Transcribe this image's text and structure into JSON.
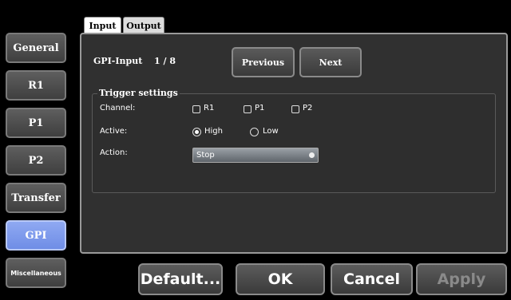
{
  "sidebar": {
    "items": [
      {
        "label": "General"
      },
      {
        "label": "R1"
      },
      {
        "label": "P1"
      },
      {
        "label": "P2"
      },
      {
        "label": "Transfer"
      },
      {
        "label": "GPI"
      },
      {
        "label": "Miscellaneous"
      }
    ],
    "active": "GPI"
  },
  "tabs": [
    {
      "label": "Input"
    },
    {
      "label": "Output"
    }
  ],
  "gpi": {
    "label": "GPI-Input",
    "current": "1 / 8",
    "previous_label": "Previous",
    "next_label": "Next"
  },
  "trigger": {
    "title": "Trigger settings",
    "channel_label": "Channel:",
    "channels": [
      "R1",
      "P1",
      "P2"
    ],
    "active_label": "Active:",
    "active_options": [
      "High",
      "Low"
    ],
    "active_selected": "High",
    "action_label": "Action:",
    "action_value": "Stop"
  },
  "footer": {
    "default_label": "Default...",
    "ok_label": "OK",
    "cancel_label": "Cancel",
    "apply_label": "Apply"
  },
  "colors": {
    "active_nav": "#7f9bee",
    "panel": "#303030",
    "background": "#000000"
  }
}
